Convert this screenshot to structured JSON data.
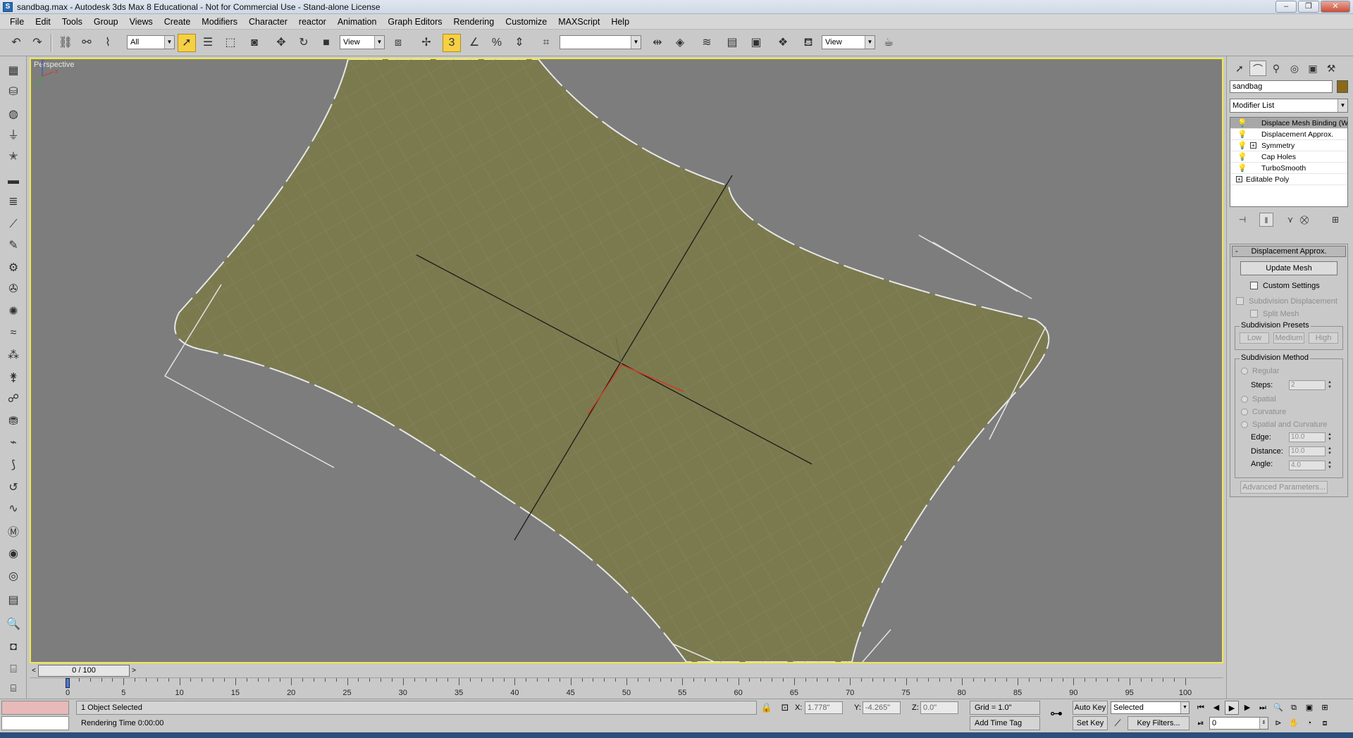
{
  "window": {
    "title": "sandbag.max - Autodesk 3ds Max 8  Educational - Not for Commercial Use - Stand-alone License",
    "minimize": "–",
    "maximize": "❐",
    "close": "✕"
  },
  "menu": [
    "File",
    "Edit",
    "Tools",
    "Group",
    "Views",
    "Create",
    "Modifiers",
    "Character",
    "reactor",
    "Animation",
    "Graph Editors",
    "Rendering",
    "Customize",
    "MAXScript",
    "Help"
  ],
  "toolbar": {
    "selection_filter": "All",
    "ref_coord_1": "View",
    "named_selection": "",
    "ref_coord_2": "View",
    "snap_label": "3"
  },
  "viewport": {
    "label": "Perspective",
    "object_color": "#7b7a4f",
    "background_color": "#7d7d7d",
    "axis_x": "x",
    "axis_y": "y",
    "axis_z": "z"
  },
  "command_panel": {
    "object_name": "sandbag",
    "object_color": "#8a6a18",
    "modifier_list": "Modifier List",
    "stack": [
      {
        "label": "Displace Mesh Binding (W",
        "selected": true,
        "expandable": false
      },
      {
        "label": "Displacement Approx.",
        "selected": false,
        "expandable": false
      },
      {
        "label": "Symmetry",
        "selected": false,
        "expandable": true
      },
      {
        "label": "Cap Holes",
        "selected": false,
        "expandable": false
      },
      {
        "label": "TurboSmooth",
        "selected": false,
        "expandable": false
      },
      {
        "label": "Editable Poly",
        "selected": false,
        "expandable": true
      }
    ],
    "rollout": {
      "minus": "-",
      "title": "Displacement Approx.",
      "update_mesh": "Update Mesh",
      "custom_settings": "Custom Settings",
      "subdivision_displacement": "Subdivision Displacement",
      "split_mesh": "Split Mesh",
      "presets_title": "Subdivision Presets",
      "preset_low": "Low",
      "preset_medium": "Medium",
      "preset_high": "High",
      "method_title": "Subdivision Method",
      "regular": "Regular",
      "steps_label": "Steps:",
      "steps_value": "2",
      "spatial": "Spatial",
      "curvature": "Curvature",
      "spatial_curvature": "Spatial and Curvature",
      "edge_label": "Edge:",
      "edge_value": "10.0",
      "distance_label": "Distance:",
      "distance_value": "10.0",
      "angle_label": "Angle:",
      "angle_value": "4.0",
      "advanced": "Advanced Parameters..."
    }
  },
  "time_slider": {
    "value": "0 / 100",
    "prev": "<",
    "next": ">"
  },
  "trackbar": {
    "ticks": [
      "0",
      "5",
      "10",
      "15",
      "20",
      "25",
      "30",
      "35",
      "40",
      "45",
      "50",
      "55",
      "60",
      "65",
      "70",
      "75",
      "80",
      "85",
      "90",
      "95",
      "100"
    ]
  },
  "status": {
    "selection": "1 Object Selected",
    "prompt": "Rendering Time  0:00:00",
    "x_label": "X:",
    "x_value": "1.778\"",
    "y_label": "Y:",
    "y_value": "-4.265\"",
    "z_label": "Z:",
    "z_value": "0.0\"",
    "grid": "Grid = 1.0\"",
    "add_time_tag": "Add Time Tag",
    "auto_key": "Auto Key",
    "set_key": "Set Key",
    "key_mode": "Selected",
    "key_filters": "Key Filters...",
    "frame": "0"
  }
}
